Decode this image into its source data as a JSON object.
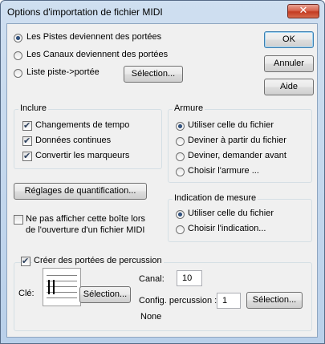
{
  "window": {
    "title": "Options d'importation de fichier MIDI"
  },
  "import_mode": {
    "options": [
      {
        "label": "Les Pistes deviennent des portées",
        "selected": true
      },
      {
        "label": "Les Canaux deviennent des portées",
        "selected": false
      },
      {
        "label": "Liste piste->portée",
        "selected": false
      }
    ],
    "selection_button": "Sélection..."
  },
  "buttons": {
    "ok": "OK",
    "cancel": "Annuler",
    "help": "Aide"
  },
  "include": {
    "label": "Inclure",
    "items": [
      {
        "label": "Changements de tempo",
        "checked": true
      },
      {
        "label": "Données continues",
        "checked": true
      },
      {
        "label": "Convertir les marqueurs",
        "checked": true
      }
    ]
  },
  "key_signature": {
    "label": "Armure",
    "options": [
      {
        "label": "Utiliser celle du fichier",
        "selected": true
      },
      {
        "label": "Deviner à partir du fichier",
        "selected": false
      },
      {
        "label": "Deviner, demander avant",
        "selected": false
      },
      {
        "label": "Choisir l'armure ...",
        "selected": false
      }
    ]
  },
  "quantize_button": "Réglages de quantification...",
  "time_signature": {
    "label": "Indication de mesure",
    "options": [
      {
        "label": "Utiliser celle du fichier",
        "selected": true
      },
      {
        "label": "Choisir l'indication...",
        "selected": false
      }
    ]
  },
  "hide_dialog": {
    "line1": "Ne pas afficher cette boîte lors",
    "line2": "de l'ouverture d'un fichier MIDI",
    "checked": false
  },
  "percussion": {
    "label": "Créer des portées de percussion",
    "checked": true,
    "clef_label": "Clé:",
    "clef_button": "Sélection...",
    "channel_label": "Canal:",
    "channel_value": "10",
    "config_label": "Config. percussion :",
    "config_value": "1",
    "config_button": "Sélection...",
    "config_name": "None"
  }
}
